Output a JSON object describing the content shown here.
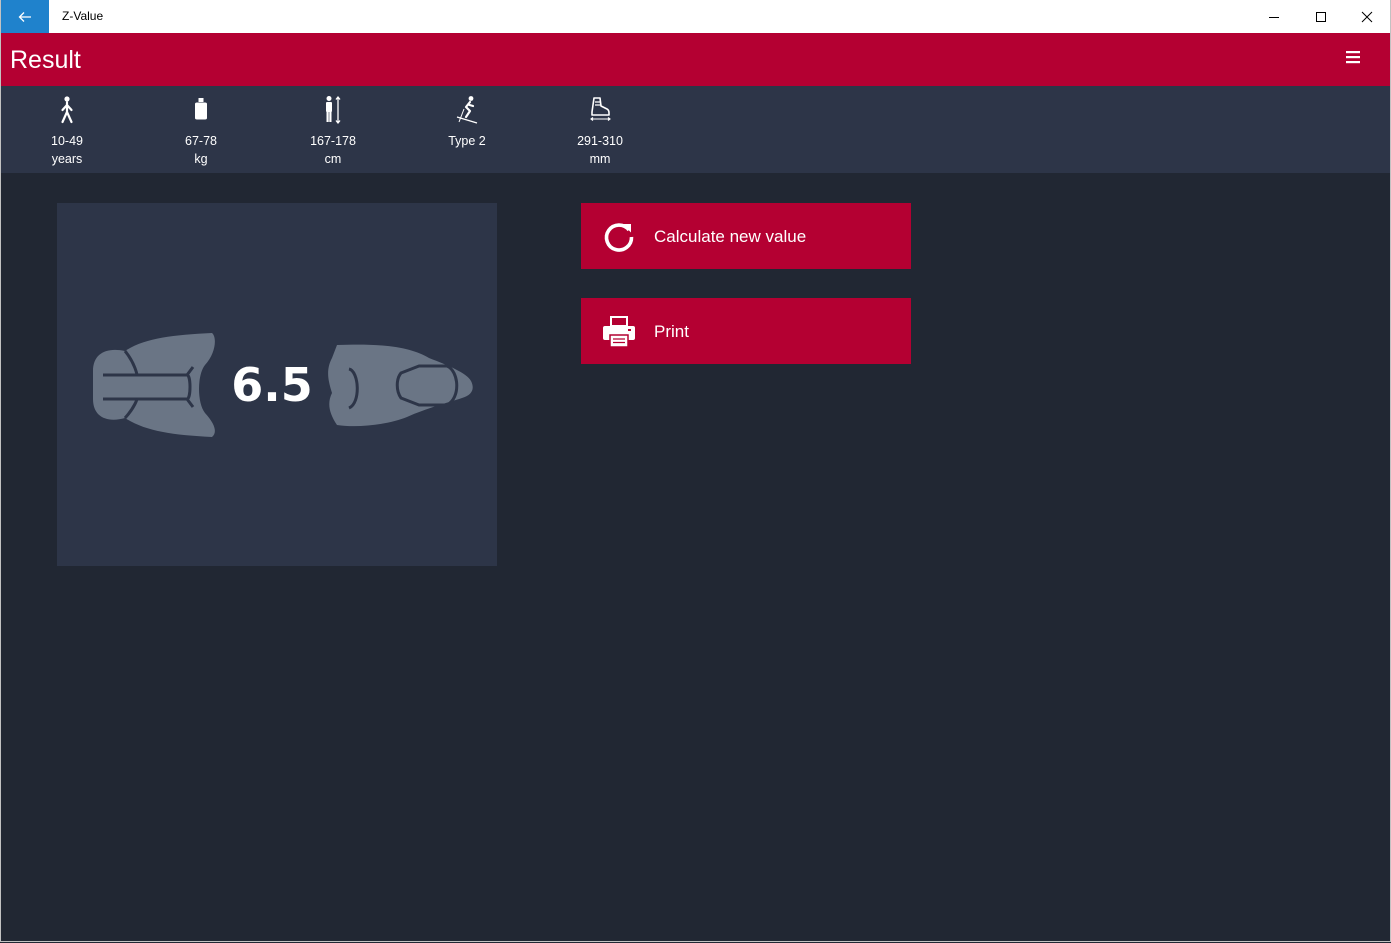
{
  "window": {
    "title": "Z-Value"
  },
  "header": {
    "title": "Result"
  },
  "summary": [
    {
      "icon": "walking-person-icon",
      "line1": "10-49",
      "line2": "years"
    },
    {
      "icon": "weight-icon",
      "line1": "67-78",
      "line2": "kg"
    },
    {
      "icon": "height-icon",
      "line1": "167-178",
      "line2": "cm"
    },
    {
      "icon": "skier-icon",
      "line1": "Type 2",
      "line2": ""
    },
    {
      "icon": "ski-boot-icon",
      "line1": "291-310",
      "line2": "mm"
    }
  ],
  "result": {
    "z_value": "6.5"
  },
  "actions": {
    "calculate_label": "Calculate new value",
    "print_label": "Print"
  },
  "colors": {
    "accent": "#b40032",
    "summary_bg": "#2d3548",
    "page_bg": "#212733",
    "back_button": "#1f82cc",
    "binding_gray": "#6a7585"
  }
}
